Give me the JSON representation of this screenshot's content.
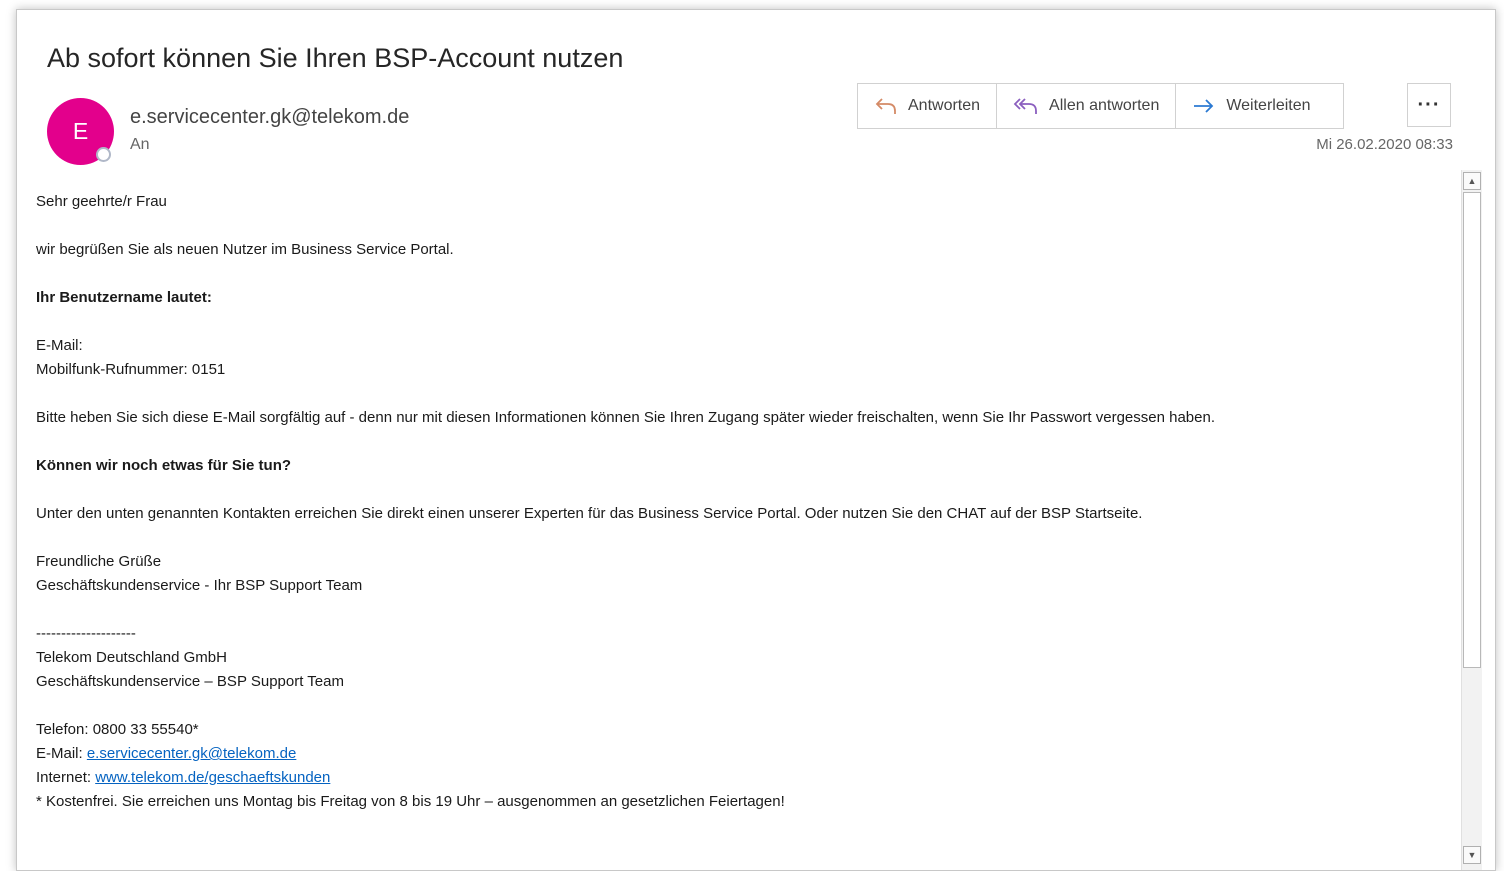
{
  "email": {
    "subject": "Ab sofort können Sie Ihren BSP-Account nutzen",
    "avatar_initial": "E",
    "avatar_color": "#e3008c",
    "sender": "e.servicecenter.gk@telekom.de",
    "to_label": "An",
    "date": "Mi 26.02.2020 08:33"
  },
  "actions": {
    "reply": "Antworten",
    "reply_all": "Allen antworten",
    "forward": "Weiterleiten",
    "more": "···"
  },
  "body": {
    "greeting": "Sehr geehrte/r Frau",
    "welcome": "wir begrüßen Sie als neuen Nutzer im Business Service Portal.",
    "username_heading": "Ihr Benutzername lautet:",
    "email_label": "E-Mail:",
    "mobile_line": "Mobilfunk-Rufnummer: 0151",
    "keep_notice": "Bitte heben Sie sich diese E-Mail sorgfältig auf - denn nur mit diesen Informationen können Sie Ihren Zugang später wieder freischalten, wenn Sie Ihr Passwort vergessen haben.",
    "help_heading": "Können wir noch etwas für Sie tun?",
    "contact_text": "Unter den unten genannten Kontakten erreichen Sie direkt einen unserer Experten für das Business Service Portal. Oder nutzen Sie den CHAT auf der BSP Startseite.",
    "closing": "Freundliche Grüße",
    "team": "Geschäftskundenservice - Ihr BSP Support Team",
    "separator": "--------------------",
    "company": "Telekom Deutschland GmbH",
    "team2": "Geschäftskundenservice – BSP Support Team",
    "phone": "Telefon: 0800 33 55540*",
    "mail_label": "E-Mail: ",
    "mail_link": "e.servicecenter.gk@telekom.de",
    "internet_label": "Internet: ",
    "internet_link": "www.telekom.de/geschaeftskunden",
    "footnote": "* Kostenfrei. Sie erreichen uns Montag bis Freitag von 8 bis 19 Uhr – ausgenommen an gesetzlichen Feiertagen!"
  },
  "colors": {
    "accent": "#0563c1",
    "icon_blue": "#2b79d2",
    "icon_purple": "#8b5fbf",
    "icon_orange": "#d48a66"
  }
}
